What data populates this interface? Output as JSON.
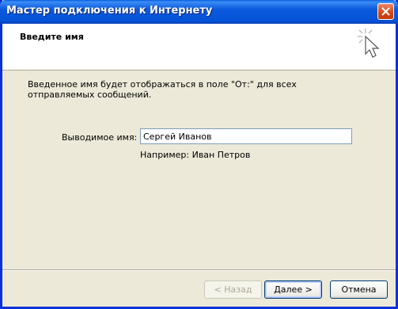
{
  "window": {
    "title": "Мастер подключения к Интернету"
  },
  "header": {
    "title": "Введите имя"
  },
  "description": "Введенное имя будет отображаться в поле \"От:\" для всех отправляемых сообщений.",
  "form": {
    "display_name_label": "Выводимое имя:",
    "display_name_value": "Сергей Иванов",
    "example": "Например: Иван Петров"
  },
  "buttons": {
    "back": "< Назад",
    "next": "Далее >",
    "cancel": "Отмена"
  }
}
